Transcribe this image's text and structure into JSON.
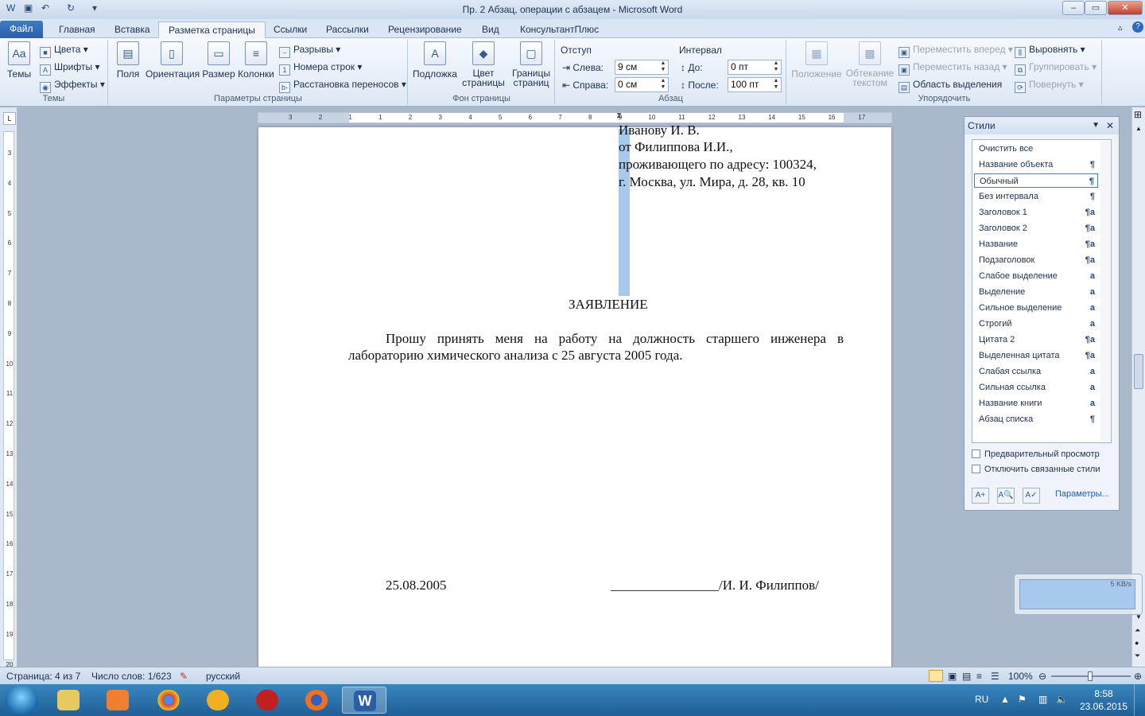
{
  "window": {
    "title": "Пр. 2 Абзац, операции с абзацем - Microsoft Word",
    "controls": {
      "minimize": "–",
      "maximize": "▭",
      "close": "✕"
    }
  },
  "quick_access": {
    "save_icon": "save-icon",
    "undo": "↶",
    "redo": "↻"
  },
  "tabs": [
    {
      "label": "Файл"
    },
    {
      "label": "Главная"
    },
    {
      "label": "Вставка"
    },
    {
      "label": "Разметка страницы"
    },
    {
      "label": "Ссылки"
    },
    {
      "label": "Рассылки"
    },
    {
      "label": "Рецензирование"
    },
    {
      "label": "Вид"
    },
    {
      "label": "КонсультантПлюс"
    }
  ],
  "ribbon": {
    "themes": {
      "group_label": "Темы",
      "themes_btn": "Темы",
      "colors": "Цвета",
      "fonts": "Шрифты",
      "effects": "Эффекты"
    },
    "page_setup": {
      "group_label": "Параметры страницы",
      "margins": "Поля",
      "orientation": "Ориентация",
      "size": "Размер",
      "columns": "Колонки",
      "breaks": "Разрывы",
      "line_numbers": "Номера строк",
      "hyphenation": "Расстановка переносов"
    },
    "page_background": {
      "group_label": "Фон страницы",
      "watermark": "Подложка",
      "page_color_1": "Цвет",
      "page_color_2": "страницы",
      "page_borders_1": "Границы",
      "page_borders_2": "страниц"
    },
    "paragraph": {
      "group_label": "Абзац",
      "indent_label": "Отступ",
      "left_label": "Слева:",
      "left_value": "9 см",
      "right_label": "Справа:",
      "right_value": "0 см",
      "spacing_label": "Интервал",
      "before_label": "До:",
      "before_value": "0 пт",
      "after_label": "После:",
      "after_value": "100 пт"
    },
    "arrange": {
      "group_label": "Упорядочить",
      "position": "Положение",
      "wrap_1": "Обтекание",
      "wrap_2": "текстом",
      "bring_forward": "Переместить вперед",
      "send_backward": "Переместить назад",
      "selection_pane": "Область выделения",
      "align": "Выровнять",
      "group": "Группировать",
      "rotate": "Повернуть"
    }
  },
  "ruler": {
    "h_ticks": [
      "3",
      "2",
      "1",
      "1",
      "2",
      "3",
      "4",
      "5",
      "6",
      "7",
      "8",
      "9",
      "10",
      "11",
      "12",
      "13",
      "14",
      "15",
      "16",
      "17"
    ],
    "v_ticks": [
      "3",
      "4",
      "5",
      "6",
      "7",
      "8",
      "9",
      "10",
      "11",
      "12",
      "13",
      "14",
      "15",
      "16",
      "17",
      "18",
      "19",
      "20"
    ]
  },
  "document": {
    "addressee_lines": [
      "Иванову И. В.",
      "от Филиппова И.И.,",
      "проживающего по адресу: 100324,",
      "г. Москва, ул. Мира, д. 28, кв. 10"
    ],
    "heading": "ЗАЯВЛЕНИЕ",
    "body_line_1": "Прошу  принять  меня  на  работу  на  должность  старшего  инженера  в",
    "body_line_2": "лабораторию химического анализа с 25 августа 2005 года.",
    "date": "25.08.2005",
    "signature": "________________/И. И. Филиппов/"
  },
  "styles_pane": {
    "title": "Стили",
    "items": [
      {
        "label": "Очистить все",
        "mark": ""
      },
      {
        "label": "Название объекта",
        "mark": "¶"
      },
      {
        "label": "Обычный",
        "mark": "¶"
      },
      {
        "label": "Без интервала",
        "mark": "¶"
      },
      {
        "label": "Заголовок 1",
        "mark": "¶a"
      },
      {
        "label": "Заголовок 2",
        "mark": "¶a"
      },
      {
        "label": "Название",
        "mark": "¶a"
      },
      {
        "label": "Подзаголовок",
        "mark": "¶a"
      },
      {
        "label": "Слабое выделение",
        "mark": "a"
      },
      {
        "label": "Выделение",
        "mark": "a"
      },
      {
        "label": "Сильное выделение",
        "mark": "a"
      },
      {
        "label": "Строгий",
        "mark": "a"
      },
      {
        "label": "Цитата 2",
        "mark": "¶a"
      },
      {
        "label": "Выделенная цитата",
        "mark": "¶a"
      },
      {
        "label": "Слабая ссылка",
        "mark": "a"
      },
      {
        "label": "Сильная ссылка",
        "mark": "a"
      },
      {
        "label": "Название книги",
        "mark": "a"
      },
      {
        "label": "Абзац списка",
        "mark": "¶"
      }
    ],
    "selected": "Обычный",
    "preview_label": "Предварительный просмотр",
    "linked_label": "Отключить связанные стили",
    "options_link": "Параметры..."
  },
  "net_widget": {
    "speed": "5 KB/s"
  },
  "statusbar": {
    "page": "Страница: 4 из 7",
    "words": "Число слов: 1/623",
    "language": "русский",
    "zoom": "100%"
  },
  "taskbar": {
    "lang": "RU",
    "time": "8:58",
    "date": "23.06.2015",
    "apps": [
      "explorer-icon",
      "media-player-icon",
      "chrome-icon",
      "mail-icon",
      "app-icon",
      "firefox-icon",
      "word-icon"
    ]
  },
  "colors": {
    "accent": "#2a5ea8",
    "selection": "#a8c9ee",
    "taskbar": "#1f5f96"
  }
}
